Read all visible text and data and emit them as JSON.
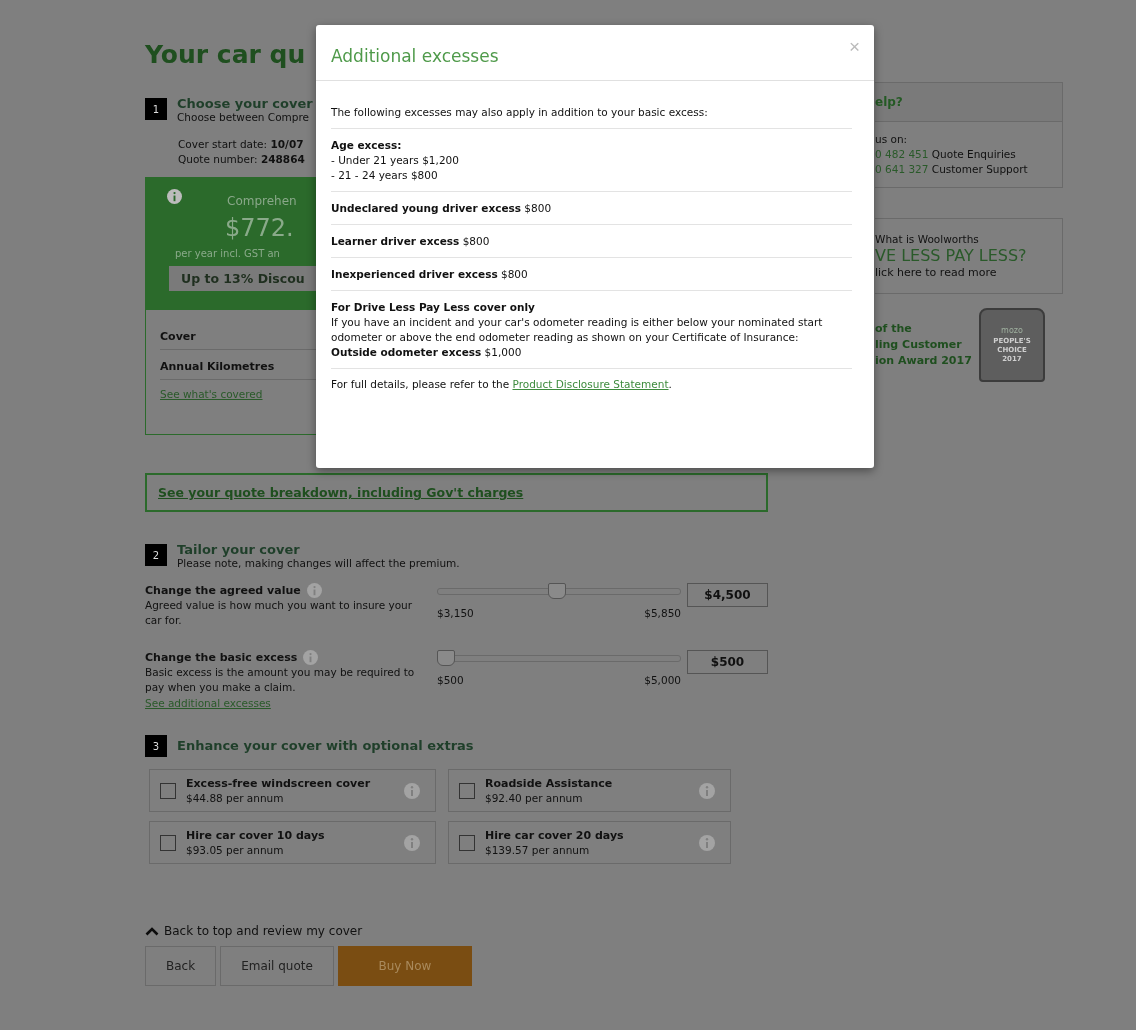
{
  "page": {
    "title": "Your car qu",
    "step1": {
      "number": "1",
      "title": "Choose your cover",
      "subtitle": "Choose between Compre",
      "start_date": "Cover start date: **10/07**",
      "quote_number": "Quote number: **248864**"
    },
    "quote_card": {
      "label": "Comprehen",
      "price": "$772.",
      "note": "per year incl. GST an",
      "discount": "Up to 13% Discou"
    },
    "summary_rows": [
      "Cover",
      "Annual Kilometres"
    ],
    "covered_link": "See what's covered",
    "breakdown_link": "See your quote breakdown, including Gov't charges",
    "step2": {
      "number": "2",
      "title": "Tailor your cover",
      "subtitle": "Please note, making changes will affect the premium."
    },
    "sliders": [
      {
        "label": "Change the agreed value",
        "description": "Agreed value is how much you want to insure your car for.",
        "min": "$3,150",
        "max": "$5,850",
        "level": 0.5,
        "value": "$4,500"
      },
      {
        "label": "Change the basic excess",
        "description": "Basic excess is the amount you may be required to pay when you make a claim.",
        "min": "$500",
        "max": "$5,000",
        "level": 0,
        "value": "$500",
        "link": "See additional excesses"
      }
    ],
    "step3": {
      "number": "3",
      "title": "Enhance your cover with optional extras"
    },
    "extras": [
      {
        "name": "Excess-free windscreen cover",
        "price": "$44.88 per annum",
        "checked": false
      },
      {
        "name": "Roadside Assistance",
        "price": "$92.40 per annum",
        "checked": false
      },
      {
        "name": "Hire car cover 10 days",
        "price": "$93.05 per annum",
        "checked": false
      },
      {
        "name": "Hire car cover 20 days",
        "price": "$139.57 per annum",
        "checked": false
      }
    ],
    "back_to_top": "Back to top and review my cover",
    "buttons": [
      {
        "label": "Back",
        "kind": "plain"
      },
      {
        "label": "Email quote",
        "kind": "plain"
      },
      {
        "label": "Buy Now",
        "kind": "primary"
      }
    ]
  },
  "sidebar": {
    "help_title": "elp?",
    "contact_intro": "us on:",
    "phones": [
      {
        "number": "0 482 451",
        "label": "Quote Enquiries"
      },
      {
        "number": "0 641 327",
        "label": "Customer Support"
      }
    ],
    "promo": {
      "intro": "What is Woolworths",
      "headline": "VE LESS PAY LESS?",
      "link": "lick here to read more"
    },
    "award": {
      "lines": [
        "of the",
        "ling Customer",
        "ion Award 2017"
      ],
      "badge": [
        "mozo",
        "PEOPLE'S",
        "CHOICE",
        "2017"
      ]
    }
  },
  "modal": {
    "title": "Additional excesses",
    "close": "×",
    "intro": "The following excesses may also apply in addition to your basic excess:",
    "sections": [
      {
        "kind": "list",
        "heading": "Age excess:",
        "lines": [
          "- Under 21 years $1,200",
          "- 21 - 24 years $800"
        ]
      },
      {
        "kind": "line",
        "text": "**Undeclared young driver excess** $800"
      },
      {
        "kind": "line",
        "text": "**Learner driver excess** $800"
      },
      {
        "kind": "line",
        "text": "**Inexperienced driver excess** $800"
      },
      {
        "kind": "para",
        "heading": "For Drive Less Pay Less cover only",
        "text": "If you have an incident and your car's odometer reading is either below your nominated start odometer or above the end odometer reading as shown on your Certificate of Insurance:",
        "footer": "**Outside odometer excess** $1,000"
      }
    ],
    "footer_before": "For full details, please refer to the",
    "footer_link": "Product Disclosure Statement",
    "footer_after": "."
  }
}
